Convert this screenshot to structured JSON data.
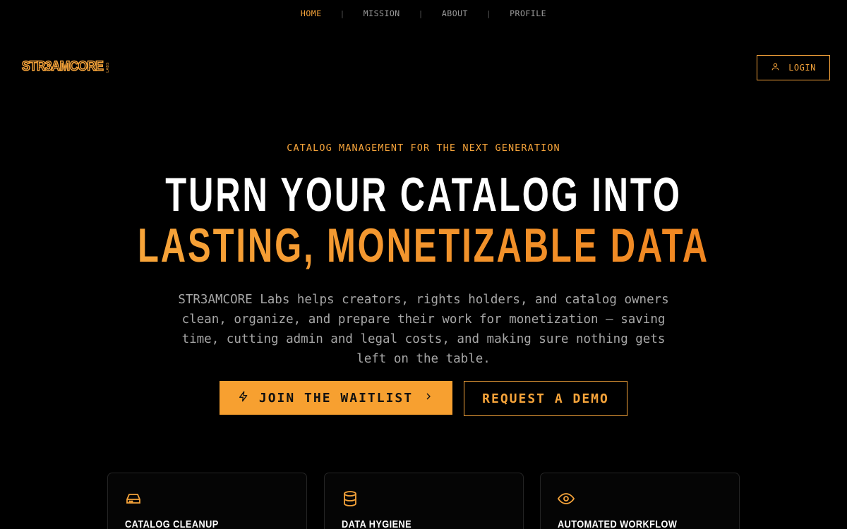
{
  "nav": {
    "items": [
      {
        "label": "HOME",
        "active": true
      },
      {
        "label": "MISSION",
        "active": false
      },
      {
        "label": "ABOUT",
        "active": false
      },
      {
        "label": "PROFILE",
        "active": false
      }
    ],
    "separator": "|"
  },
  "header": {
    "logo_text": "STR3AMCORE",
    "logo_sub": "LABS",
    "login_label": "LOGIN",
    "login_icon": "user-icon"
  },
  "hero": {
    "eyebrow": "CATALOG MANAGEMENT FOR THE NEXT GENERATION",
    "headline_line1": "TURN YOUR CATALOG INTO",
    "headline_line2": "LASTING, MONETIZABLE DATA",
    "description": "STR3AMCORE Labs helps creators, rights holders, and catalog owners clean, organize, and prepare their work for monetization — saving time, cutting admin and legal costs, and making sure nothing gets left on the table.",
    "primary_cta": "JOIN THE WAITLIST",
    "primary_cta_icon": "lightning-icon",
    "primary_cta_trailing_icon": "chevron-right-icon",
    "secondary_cta": "REQUEST A DEMO"
  },
  "features": [
    {
      "title": "CATALOG CLEANUP",
      "icon": "hard-drive-icon"
    },
    {
      "title": "DATA HYGIENE",
      "icon": "database-icon"
    },
    {
      "title": "AUTOMATED WORKFLOW",
      "icon": "eye-icon"
    }
  ],
  "colors": {
    "background": "#000000",
    "accent": "#f5a33a",
    "accent_button": "#f7a030",
    "text_primary": "#ffffff",
    "text_muted": "#a7a7a7"
  }
}
